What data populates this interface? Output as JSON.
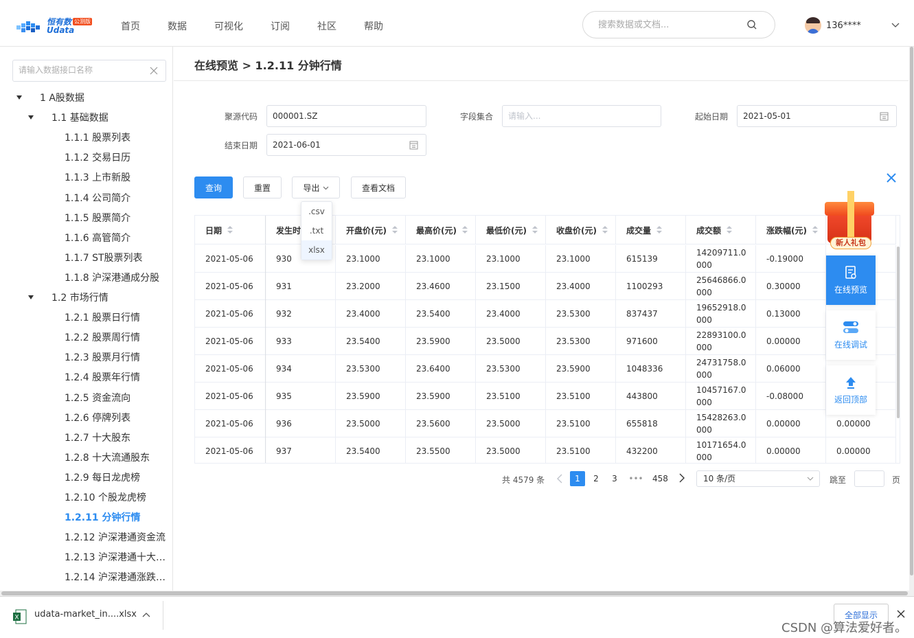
{
  "header": {
    "logo_title": "恒有数",
    "logo_sub": "Udata",
    "logo_badge": "公测版",
    "nav": [
      "首页",
      "数据",
      "可视化",
      "订阅",
      "社区",
      "帮助"
    ],
    "search_placeholder": "搜索数据或文档...",
    "user_name": "136****"
  },
  "sidebar": {
    "search_placeholder": "请输入数据接口名称",
    "items": [
      {
        "label": "1 A股数据",
        "level": 0,
        "expanded": true
      },
      {
        "label": "1.1 基础数据",
        "level": 1,
        "expanded": true
      },
      {
        "label": "1.1.1 股票列表",
        "level": 2
      },
      {
        "label": "1.1.2 交易日历",
        "level": 2
      },
      {
        "label": "1.1.3 上市新股",
        "level": 2
      },
      {
        "label": "1.1.4 公司简介",
        "level": 2
      },
      {
        "label": "1.1.5 股票简介",
        "level": 2
      },
      {
        "label": "1.1.6 高管简介",
        "level": 2
      },
      {
        "label": "1.1.7 ST股票列表",
        "level": 2
      },
      {
        "label": "1.1.8 沪深港通成分股",
        "level": 2
      },
      {
        "label": "1.2 市场行情",
        "level": 1,
        "expanded": true
      },
      {
        "label": "1.2.1 股票日行情",
        "level": 2
      },
      {
        "label": "1.2.2 股票周行情",
        "level": 2
      },
      {
        "label": "1.2.3 股票月行情",
        "level": 2
      },
      {
        "label": "1.2.4 股票年行情",
        "level": 2
      },
      {
        "label": "1.2.5 资金流向",
        "level": 2
      },
      {
        "label": "1.2.6 停牌列表",
        "level": 2
      },
      {
        "label": "1.2.7 十大股东",
        "level": 2
      },
      {
        "label": "1.2.8 十大流通股东",
        "level": 2
      },
      {
        "label": "1.2.9 每日龙虎榜",
        "level": 2
      },
      {
        "label": "1.2.10 个股龙虎榜",
        "level": 2
      },
      {
        "label": "1.2.11 分钟行情",
        "level": 2,
        "active": true
      },
      {
        "label": "1.2.12 沪深港通资金流",
        "level": 2
      },
      {
        "label": "1.2.13 沪深港通十大…",
        "level": 2
      },
      {
        "label": "1.2.14 沪深港通涨跌…",
        "level": 2
      }
    ]
  },
  "main": {
    "breadcrumb": "在线预览 > 1.2.11 分钟行情",
    "form": {
      "code_label": "聚源代码",
      "code_value": "000001.SZ",
      "fields_label": "字段集合",
      "fields_placeholder": "请输入...",
      "start_label": "起始日期",
      "start_value": "2021-05-01",
      "end_label": "结束日期",
      "end_value": "2021-06-01"
    },
    "buttons": {
      "query": "查询",
      "reset": "重置",
      "export": "导出",
      "docs": "查看文档"
    },
    "export_options": [
      ".csv",
      ".txt",
      "xlsx"
    ],
    "table": {
      "columns": [
        "日期",
        "发生时间",
        "开盘价(元)",
        "最高价(元)",
        "最低价(元)",
        "收盘价(元)",
        "成交量",
        "成交额",
        "涨跌幅(元)",
        ""
      ],
      "rows": [
        [
          "2021-05-06",
          "930",
          "23.1000",
          "23.1000",
          "23.1000",
          "23.1000",
          "615139",
          "14209711.0000",
          "-0.19000",
          ""
        ],
        [
          "2021-05-06",
          "931",
          "23.2000",
          "23.4600",
          "23.1500",
          "23.4000",
          "1100293",
          "25646866.0000",
          "0.30000",
          ""
        ],
        [
          "2021-05-06",
          "932",
          "23.4000",
          "23.5400",
          "23.4000",
          "23.5300",
          "837437",
          "19652918.0000",
          "0.13000",
          ""
        ],
        [
          "2021-05-06",
          "933",
          "23.5400",
          "23.5900",
          "23.5000",
          "23.5300",
          "971600",
          "22893100.0000",
          "0.00000",
          ""
        ],
        [
          "2021-05-06",
          "934",
          "23.5300",
          "23.6400",
          "23.5300",
          "23.5900",
          "1048336",
          "24731758.0000",
          "0.06000",
          ""
        ],
        [
          "2021-05-06",
          "935",
          "23.5900",
          "23.5900",
          "23.5100",
          "23.5100",
          "443800",
          "10457167.0000",
          "-0.08000",
          ""
        ],
        [
          "2021-05-06",
          "936",
          "23.5000",
          "23.5600",
          "23.5000",
          "23.5100",
          "655818",
          "15428263.0000",
          "0.00000",
          "0.00000"
        ],
        [
          "2021-05-06",
          "937",
          "23.5400",
          "23.5500",
          "23.5000",
          "23.5100",
          "432200",
          "10171654.0000",
          "0.00000",
          "0.00000"
        ]
      ]
    },
    "pagination": {
      "total": "共 4579 条",
      "pages": [
        "1",
        "2",
        "3",
        "•••",
        "458"
      ],
      "active_page": "1",
      "page_size": "10 条/页",
      "jump_label": "跳至",
      "page_suffix": "页"
    }
  },
  "float_panel": {
    "gift_label": "新人礼包",
    "preview": "在线预览",
    "debug": "在线调试",
    "top": "返回顶部"
  },
  "downloads": {
    "file_name": "udata-market_in....xlsx",
    "show_all": "全部显示"
  },
  "watermark": "CSDN @算法爱好者。",
  "colors": {
    "primary": "#2d8cf0",
    "border": "#dcdfe6",
    "table_border": "#ebeef5"
  }
}
